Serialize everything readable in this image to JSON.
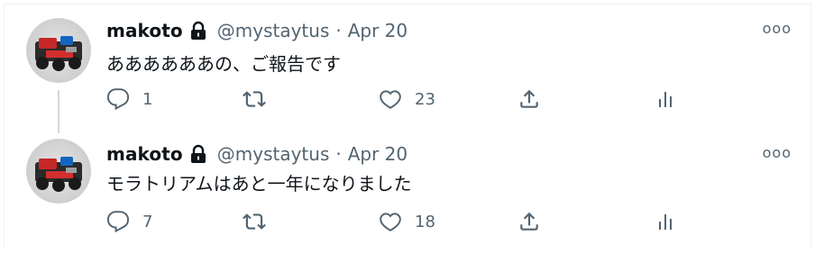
{
  "tweets": [
    {
      "author": {
        "name": "makoto",
        "handle": "@mystaytus",
        "protected_icon": "lock-icon"
      },
      "date": "Apr 20",
      "separator": "·",
      "text": "ああああああの、ご報告です",
      "more_icon": "more-icon",
      "more_label": "ooo",
      "actions": {
        "replies": "1",
        "retweets": "",
        "likes": "23"
      }
    },
    {
      "author": {
        "name": "makoto",
        "handle": "@mystaytus",
        "protected_icon": "lock-icon"
      },
      "date": "Apr 20",
      "separator": "·",
      "text": "モラトリアムはあと一年になりました",
      "more_icon": "more-icon",
      "more_label": "ooo",
      "actions": {
        "replies": "7",
        "retweets": "",
        "likes": "18"
      }
    }
  ],
  "colors": {
    "text": "#0f1419",
    "secondary": "#536471",
    "thread_line": "#cfd9de"
  }
}
